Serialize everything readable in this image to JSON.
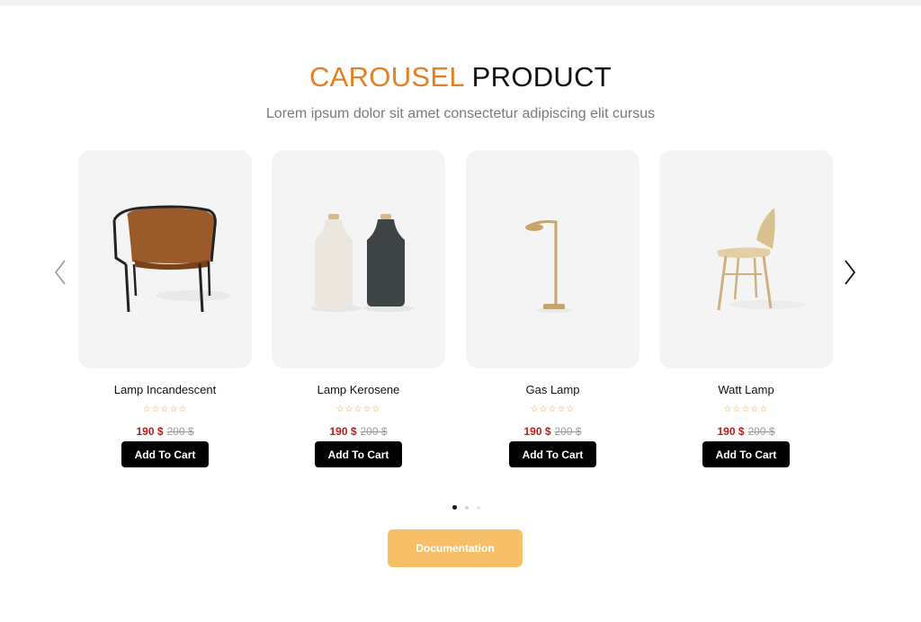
{
  "header": {
    "title_accent": "CAROUSEL",
    "title_rest": " PRODUCT",
    "subtitle": "Lorem ipsum dolor sit amet consectetur adipiscing elit cursus"
  },
  "products": [
    {
      "name": "Lamp Incandescent",
      "rating": "☆☆☆☆☆",
      "price": "190 $",
      "old_price": "200 $",
      "cart_label": "Add To Cart"
    },
    {
      "name": "Lamp Kerosene",
      "rating": "☆☆☆☆☆",
      "price": "190 $",
      "old_price": "200 $",
      "cart_label": "Add To Cart"
    },
    {
      "name": "Gas Lamp",
      "rating": "☆☆☆☆☆",
      "price": "190 $",
      "old_price": "200 $",
      "cart_label": "Add To Cart"
    },
    {
      "name": "Watt Lamp",
      "rating": "☆☆☆☆☆",
      "price": "190 $",
      "old_price": "200 $",
      "cart_label": "Add To Cart"
    }
  ],
  "pagination": {
    "active_index": 0,
    "count": 3
  },
  "documentation_label": "Documentation",
  "colors": {
    "accent": "#e67e22",
    "price": "#b71c1c",
    "button": "#000000",
    "doc_button": "#f8bf69",
    "star": "#e8a33c"
  }
}
